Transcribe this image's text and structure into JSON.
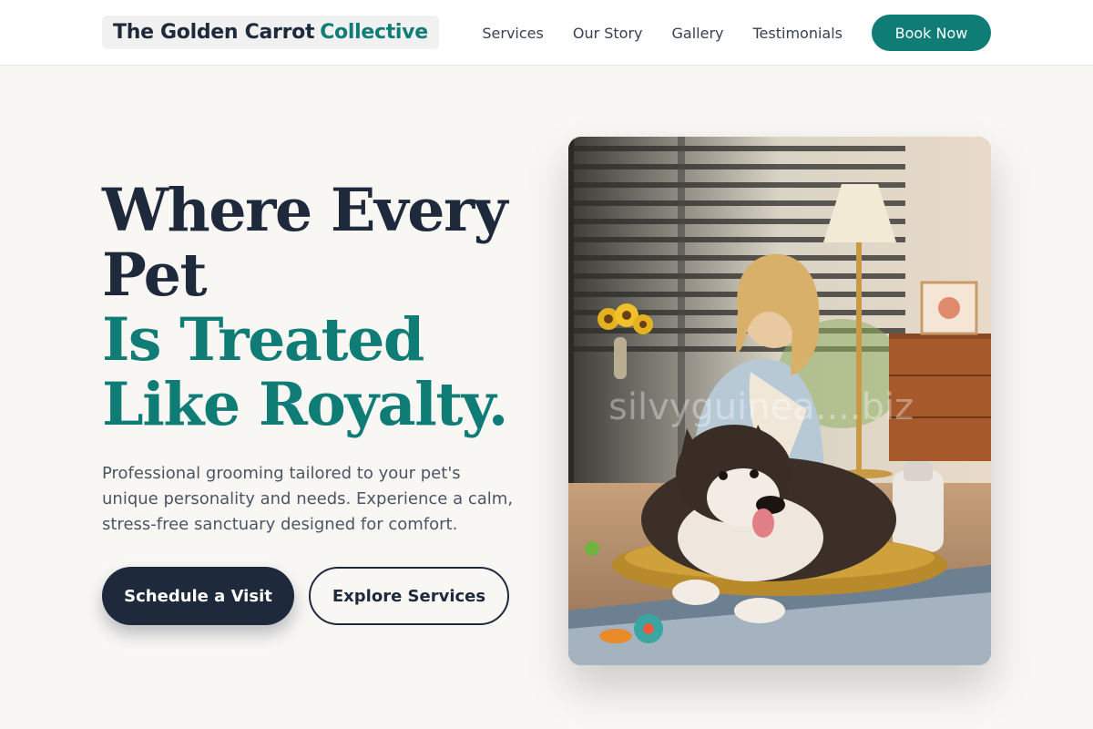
{
  "header": {
    "logo_main": "The Golden Carrot",
    "logo_accent": "Collective",
    "nav": [
      "Services",
      "Our Story",
      "Gallery",
      "Testimonials"
    ],
    "cta_label": "Book Now"
  },
  "hero": {
    "title_line1": "Where Every",
    "title_line2": "Pet",
    "title_line3": "Is Treated",
    "title_line4": "Like Royalty.",
    "description": "Professional grooming tailored to your pet's unique personality and needs. Experience a calm, stress-free sanctuary designed for comfort.",
    "primary_button": "Schedule a Visit",
    "secondary_button": "Explore Services",
    "image_watermark": "silvyguinea....biz"
  },
  "colors": {
    "background": "#f9f7f4",
    "navy": "#1e293b",
    "teal": "#0f7c76",
    "body_text": "#4b5563"
  }
}
